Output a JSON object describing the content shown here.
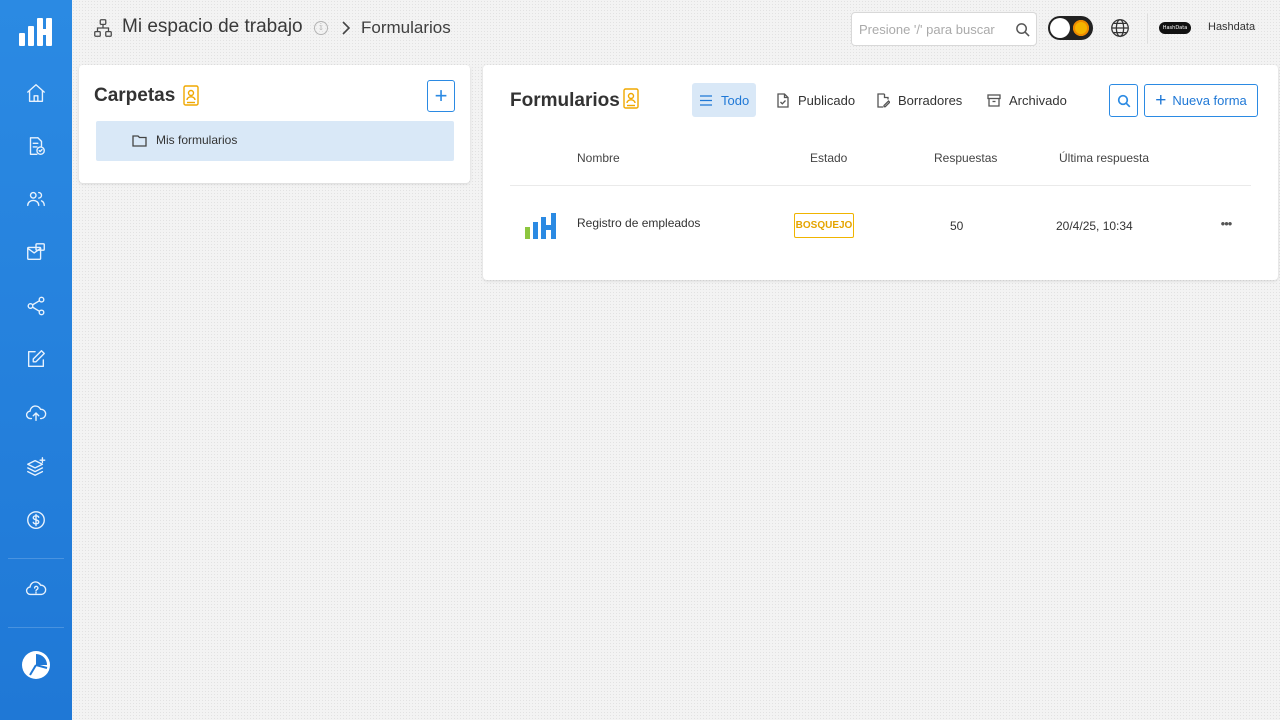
{
  "header": {
    "workspace": "Mi espacio de trabajo",
    "current": "Formularios",
    "search_placeholder": "Presione '/' para buscar",
    "username": "Hashdata",
    "avatar_text": "HashData"
  },
  "sidebar": {
    "items": [
      {
        "icon": "home-icon"
      },
      {
        "icon": "document-check-icon"
      },
      {
        "icon": "users-icon"
      },
      {
        "icon": "mail-chat-icon"
      },
      {
        "icon": "share-icon"
      },
      {
        "icon": "edit-icon"
      },
      {
        "icon": "cloud-upload-icon"
      },
      {
        "icon": "layers-icon"
      },
      {
        "icon": "dollar-icon"
      },
      {
        "icon": "cloud-help-icon"
      }
    ]
  },
  "folders": {
    "title": "Carpetas",
    "items": [
      {
        "label": "Mis formularios"
      }
    ]
  },
  "forms": {
    "title": "Formularios",
    "tabs": [
      {
        "label": "Todo",
        "active": true
      },
      {
        "label": "Publicado"
      },
      {
        "label": "Borradores"
      },
      {
        "label": "Archivado"
      }
    ],
    "new_button": "Nueva forma",
    "columns": [
      "Nombre",
      "Estado",
      "Respuestas",
      "Última respuesta"
    ],
    "rows": [
      {
        "name": "Registro de empleados",
        "status": "BOSQUEJO",
        "responses": "50",
        "last": "20/4/25, 10:34"
      }
    ]
  },
  "colors": {
    "sidebar": "#2b8ae3",
    "accent": "#1f78d6",
    "draft_badge": "#f0b400"
  }
}
